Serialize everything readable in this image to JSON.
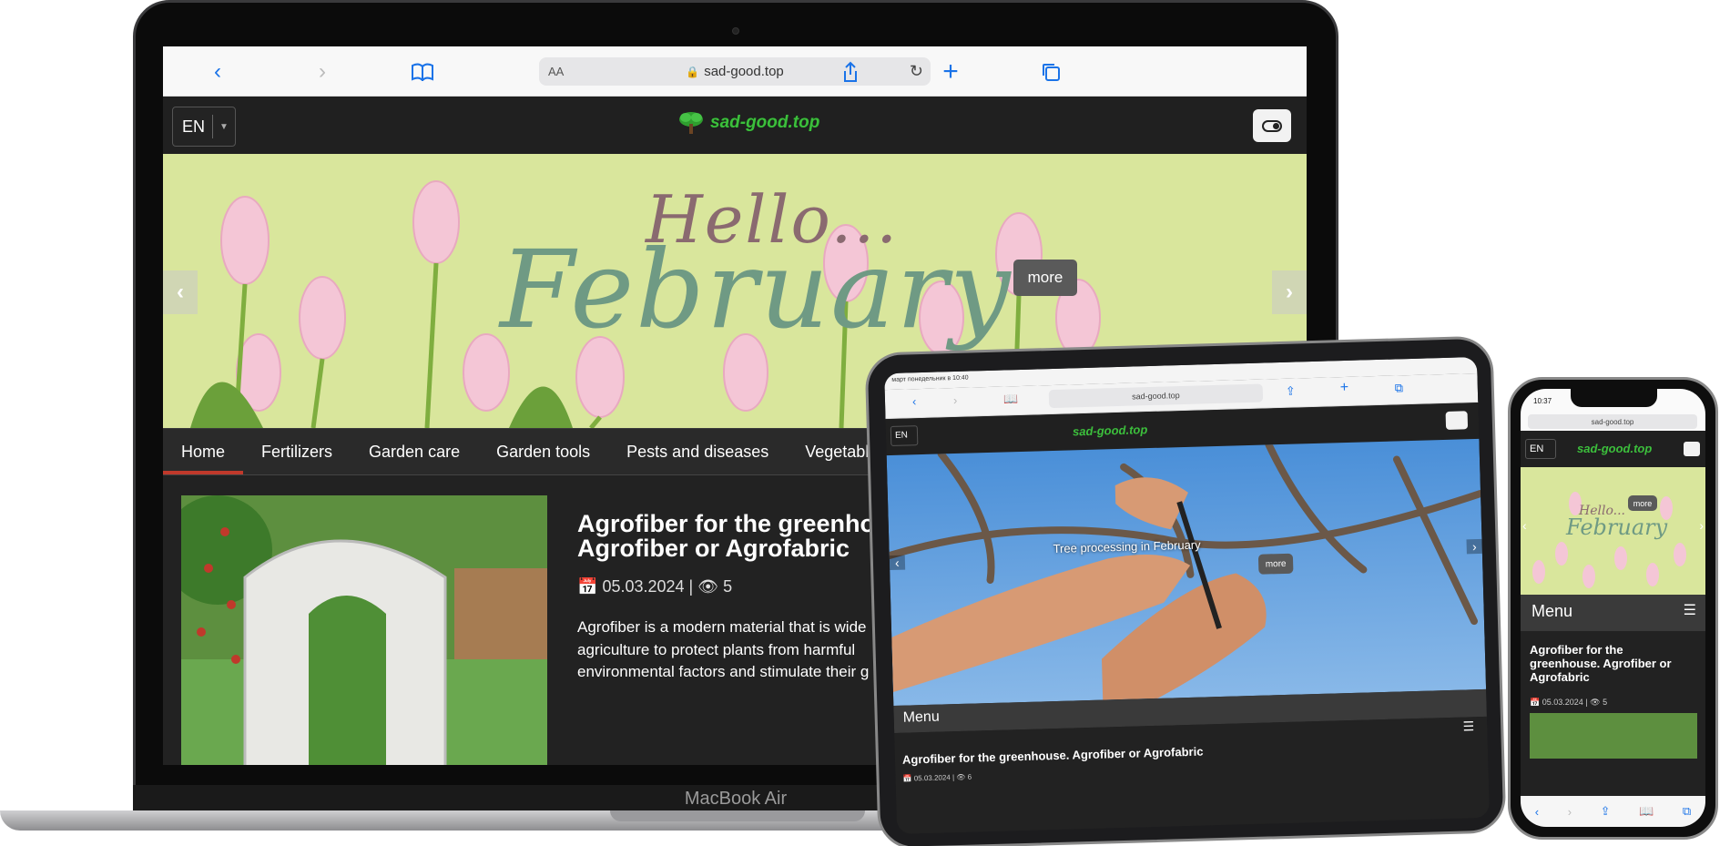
{
  "laptop": {
    "device_label": "MacBook Air",
    "safari": {
      "aa": "AA",
      "address": "sad-good.top",
      "back": "‹",
      "forward": "›"
    },
    "header": {
      "lang": "EN",
      "logo_text": "sad-good.top"
    },
    "banner": {
      "hello": "Hello...",
      "february": "February",
      "more": "more"
    },
    "menu": [
      "Home",
      "Fertilizers",
      "Garden care",
      "Garden tools",
      "Pests and diseases",
      "Vegetable ga"
    ],
    "article": {
      "title": "Agrofiber for the greenhou Agrofiber or Agrofabric",
      "date": "05.03.2024",
      "separator": "|",
      "views": "5",
      "excerpt": "Agrofiber is a modern material that is wide agriculture to protect plants from harmful environmental factors and stimulate their g"
    }
  },
  "tablet": {
    "status": "март понедельник в 10:40",
    "address": "sad-good.top",
    "lang": "EN",
    "logo_text": "sad-good.top",
    "hero_caption": "Tree processing in February",
    "more": "more",
    "menu_label": "Menu",
    "post_title": "Agrofiber for the greenhouse. Agrofiber or Agrofabric",
    "post_date": "05.03.2024",
    "post_views": "6"
  },
  "phone": {
    "time": "10:37",
    "address": "sad-good.top",
    "lang": "EN",
    "logo_text": "sad-good.top",
    "banner_hello": "Hello...",
    "banner_february": "February",
    "more": "more",
    "menu_label": "Menu",
    "post_title": "Agrofiber for the greenhouse. Agrofiber or Agrofabric",
    "post_date": "05.03.2024",
    "post_views": "5"
  },
  "colors": {
    "accent_blue": "#1a73e8",
    "logo_green": "#3cbf3c",
    "menu_active_underline": "#c0392b",
    "banner_bg": "#d9e69c"
  }
}
